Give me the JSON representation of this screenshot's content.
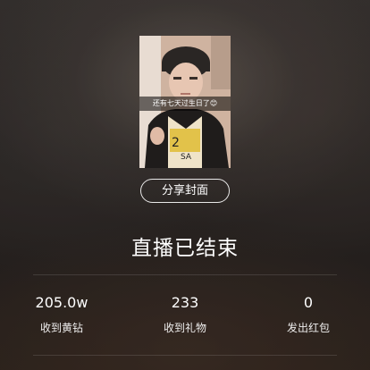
{
  "cover": {
    "caption": "还有七天过生日了😊"
  },
  "share_button": {
    "label": "分享封面"
  },
  "status": {
    "title": "直播已结束"
  },
  "stats": [
    {
      "value": "205.0w",
      "label": "收到黄钻"
    },
    {
      "value": "233",
      "label": "收到礼物"
    },
    {
      "value": "0",
      "label": "发出红包"
    }
  ]
}
